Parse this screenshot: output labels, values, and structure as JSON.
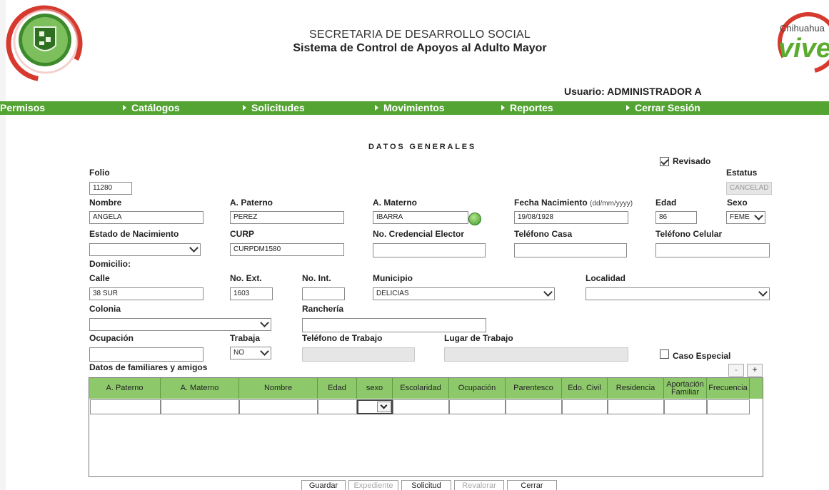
{
  "header": {
    "title_line1": "SECRETARIA DE DESARROLLO SOCIAL",
    "title_line2": "Sistema de Control de Apoyos al Adulto Mayor",
    "user": "Usuario: ADMINISTRADOR A",
    "right_logo_text": "Chihuahua",
    "right_logo_word": "vive"
  },
  "nav": {
    "items": [
      "Permisos",
      "Catálogos",
      "Solicitudes",
      "Movimientos",
      "Reportes",
      "Cerrar Sesión"
    ]
  },
  "form": {
    "section_title": "DATOS GENERALES",
    "revisado_label": "Revisado",
    "revisado_checked": true,
    "folio_label": "Folio",
    "folio": "11280",
    "estatus_label": "Estatus",
    "estatus": "CANCELAD",
    "nombre_label": "Nombre",
    "nombre": "ANGELA",
    "paterno_label": "A. Paterno",
    "paterno": "PEREZ",
    "materno_label": "A. Materno",
    "materno": "IBARRA",
    "fecha_label": "Fecha Nacimiento",
    "fecha_hint": "(dd/mm/yyyy)",
    "fecha": "19/08/1928",
    "edad_label": "Edad",
    "edad": "86",
    "sexo_label": "Sexo",
    "sexo": "FEME",
    "estado_nac_label": "Estado de Nacimiento",
    "estado_nac": "",
    "curp_label": "CURP",
    "curp": "CURPDM1580",
    "credencial_label": "No. Credencial Elector",
    "credencial": "",
    "tel_casa_label": "Teléfono Casa",
    "tel_casa": "",
    "tel_cel_label": "Teléfono Celular",
    "tel_cel": "",
    "domicilio_label": "Domicilio:",
    "calle_label": "Calle",
    "calle": "38 SUR",
    "no_ext_label": "No. Ext.",
    "no_ext": "1603",
    "no_int_label": "No. Int.",
    "no_int": "",
    "municipio_label": "Municipio",
    "municipio": "DELICIAS",
    "localidad_label": "Localidad",
    "localidad": "",
    "colonia_label": "Colonia",
    "colonia": "",
    "rancheria_label": "Ranchería",
    "rancheria": "",
    "ocupacion_label": "Ocupación",
    "ocupacion": "",
    "trabaja_label": "Trabaja",
    "trabaja": "NO",
    "tel_trabajo_label": "Teléfono de Trabajo",
    "lugar_trabajo_label": "Lugar de Trabajo",
    "caso_especial_label": "Caso Especial",
    "caso_especial_checked": false,
    "familiares_label": "Datos de familiares y amigos",
    "minus": "-",
    "plus": "+"
  },
  "table": {
    "columns": [
      "A. Paterno",
      "A. Materno",
      "Nombre",
      "Edad",
      "sexo",
      "Escolaridad",
      "Ocupación",
      "Parentesco",
      "Edo. Civil",
      "Residencia",
      "Aportación Familiar",
      "Frecuencia"
    ]
  },
  "buttons": {
    "guardar": "Guardar",
    "expediente": "Expediente",
    "solicitud": "Solicitud",
    "revalorar": "Revalorar",
    "cerrar": "Cerrar"
  },
  "colors": {
    "nav_green": "#54a434",
    "table_header_green": "#8dc96b",
    "logo_red": "#d63a2f"
  }
}
